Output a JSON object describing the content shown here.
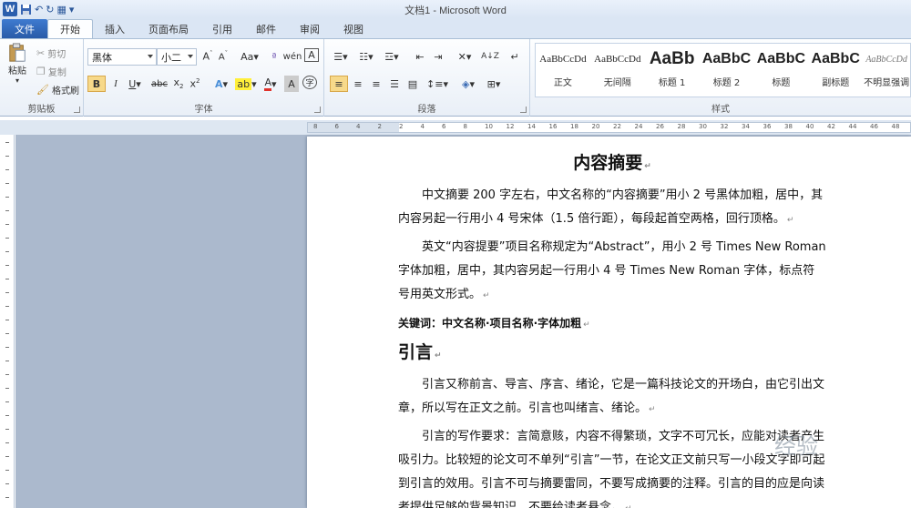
{
  "window": {
    "title": "文档1 - Microsoft Word"
  },
  "tabs": [
    {
      "label": "文件"
    },
    {
      "label": "开始"
    },
    {
      "label": "插入"
    },
    {
      "label": "页面布局"
    },
    {
      "label": "引用"
    },
    {
      "label": "邮件"
    },
    {
      "label": "审阅"
    },
    {
      "label": "视图"
    }
  ],
  "clipboard": {
    "paste": "粘贴",
    "cut": "剪切",
    "copy": "复制",
    "format_painter": "格式刷",
    "group_label": "剪贴板"
  },
  "font": {
    "family": "黑体",
    "size": "小二",
    "group_label": "字体"
  },
  "paragraph": {
    "group_label": "段落"
  },
  "styles": {
    "group_label": "样式",
    "items": [
      {
        "sample": "AaBbCcDd",
        "name": "正文"
      },
      {
        "sample": "AaBbCcDd",
        "name": "无间隔"
      },
      {
        "sample": "AaBb",
        "name": "标题 1"
      },
      {
        "sample": "AaBbC",
        "name": "标题 2"
      },
      {
        "sample": "AaBbC",
        "name": "标题"
      },
      {
        "sample": "AaBbC",
        "name": "副标题"
      },
      {
        "sample": "AaBbCcDd",
        "name": "不明显强调"
      }
    ]
  },
  "ruler": {
    "labels": [
      "8",
      "6",
      "4",
      "2",
      "2",
      "4",
      "6",
      "8",
      "10",
      "12",
      "14",
      "16",
      "18",
      "20",
      "22",
      "24",
      "26",
      "28",
      "30",
      "32",
      "34",
      "36",
      "38",
      "40",
      "42",
      "44",
      "46",
      "48"
    ]
  },
  "document": {
    "title": "内容摘要",
    "p1": "中文摘要 200 字左右，中文名称的“内容摘要”用小 2 号黑体加粗，居中，其内容另起一行用小 4 号宋体（1.5 倍行距），每段起首空两格，回行顶格。",
    "p2": "英文“内容提要”项目名称规定为“Abstract”，用小 2 号 Times New Roman 字体加粗，居中，其内容另起一行用小 4 号 Times New Roman 字体，标点符号用英文形式。",
    "keywords_label": "关键词：",
    "keywords": "中文名称·项目名称·字体加粗",
    "heading": "引言",
    "p3": "引言又称前言、导言、序言、绪论，它是一篇科技论文的开场白，由它引出文章，所以写在正文之前。引言也叫绪言、绪论。",
    "p4": "引言的写作要求：言简意赅，内容不得繁琐，文字不可冗长，应能对读者产生吸引力。比较短的论文可不单列“引言”一节，在论文正文前只写一小段文字即可起到引言的效用。引言不可与摘要雷同，不要写成摘要的注释。引言的目的应是向读者提供足够的背景知识，不要给读者悬念。",
    "para_mark": "↵"
  },
  "watermark": "经验"
}
